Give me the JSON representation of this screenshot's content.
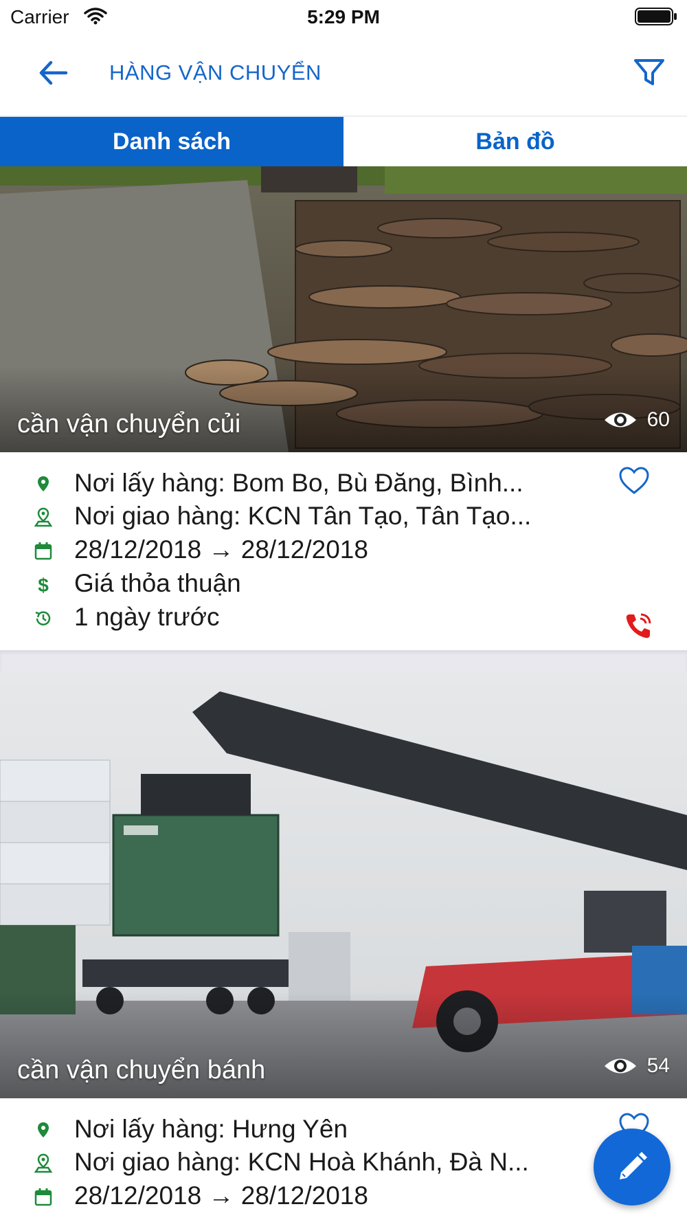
{
  "status_bar": {
    "carrier": "Carrier",
    "time": "5:29 PM",
    "icons": [
      "wifi-icon",
      "battery-icon"
    ]
  },
  "navbar": {
    "title": "HÀNG VẬN CHUYỂN",
    "back_icon": "arrow-left-icon",
    "filter_icon": "filter-icon",
    "accent_color": "#1566c9"
  },
  "tabs": [
    {
      "label": "Danh sách",
      "active": true
    },
    {
      "label": "Bản đồ",
      "active": false
    }
  ],
  "listings": [
    {
      "title": "cần vận chuyển củi",
      "views": "60",
      "pickup": "Nơi lấy hàng: Bom Bo, Bù Đăng, Bình...",
      "delivery": "Nơi giao hàng: KCN Tân Tạo, Tân Tạo...",
      "dates": "28/12/2018 → 28/12/2018",
      "price": "Giá thỏa thuận",
      "posted": "1 ngày trước",
      "image": "firewood-logs-photo"
    },
    {
      "title": "cần vận chuyển bánh",
      "views": "54",
      "pickup": "Nơi lấy hàng: Hưng Yên",
      "delivery": "Nơi giao hàng: KCN Hoà Khánh, Đà N...",
      "dates": "28/12/2018 → 28/12/2018",
      "image": "container-reach-stacker-photo"
    }
  ],
  "colors": {
    "primary": "#0a63c9",
    "icon_green": "#1e8a3a",
    "phone_red": "#e21b1b"
  },
  "fab": {
    "icon": "pencil-icon"
  }
}
